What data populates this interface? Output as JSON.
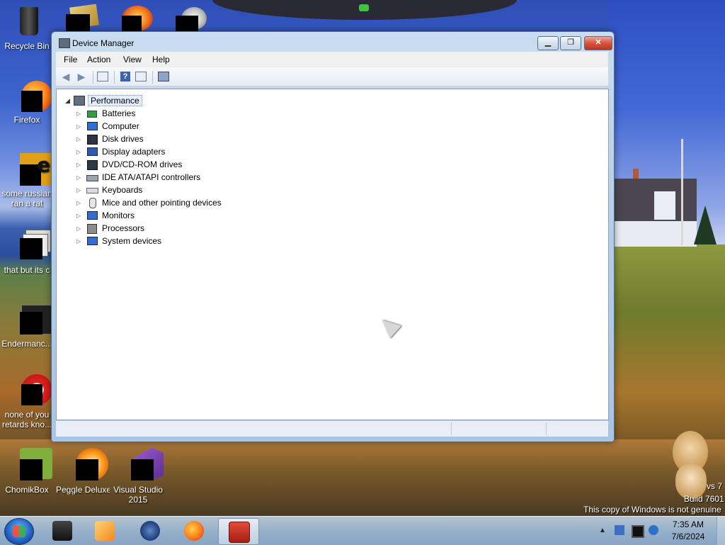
{
  "desktop": {
    "icons": [
      {
        "label": "Recycle Bin"
      },
      {
        "label": "Firefox"
      },
      {
        "label": "some russian ran a rat"
      },
      {
        "label": "that but its c"
      },
      {
        "label": "Endermanc..."
      },
      {
        "label": "none of you retards kno..."
      },
      {
        "label": "ChomikBox"
      },
      {
        "label": "Peggle Deluxe"
      },
      {
        "label": "Visual Studio 2015"
      }
    ],
    "watermark": {
      "line1": "vs 7",
      "line2": "Build 7601",
      "line3": "This copy of Windows is not genuine"
    }
  },
  "window": {
    "title": "Device Manager",
    "menu": [
      "File",
      "Action",
      "View",
      "Help"
    ],
    "buttons": {
      "min": "▁",
      "max": "❐",
      "close": "✕"
    },
    "tree": {
      "root": "Performance",
      "nodes": [
        {
          "label": "Batteries",
          "icon": "battery-icon"
        },
        {
          "label": "Computer",
          "icon": "computer-icon"
        },
        {
          "label": "Disk drives",
          "icon": "disk-drive-icon"
        },
        {
          "label": "Display adapters",
          "icon": "display-adapter-icon"
        },
        {
          "label": "DVD/CD-ROM drives",
          "icon": "dvd-drive-icon"
        },
        {
          "label": "IDE ATA/ATAPI controllers",
          "icon": "ide-controller-icon"
        },
        {
          "label": "Keyboards",
          "icon": "keyboard-icon"
        },
        {
          "label": "Mice and other pointing devices",
          "icon": "mouse-icon"
        },
        {
          "label": "Monitors",
          "icon": "monitor-icon"
        },
        {
          "label": "Processors",
          "icon": "processor-icon"
        },
        {
          "label": "System devices",
          "icon": "system-device-icon"
        }
      ]
    }
  },
  "taskbar": {
    "clock_time": "7:35 AM",
    "clock_date": "7/6/2024",
    "apps": [
      "terminal-icon",
      "media-player-icon",
      "globe-icon",
      "firefox-icon",
      "device-manager-icon"
    ]
  },
  "colors": {
    "selection": "#e5eefc",
    "close_red": "#c03420",
    "accent": "#6c8fd1"
  }
}
